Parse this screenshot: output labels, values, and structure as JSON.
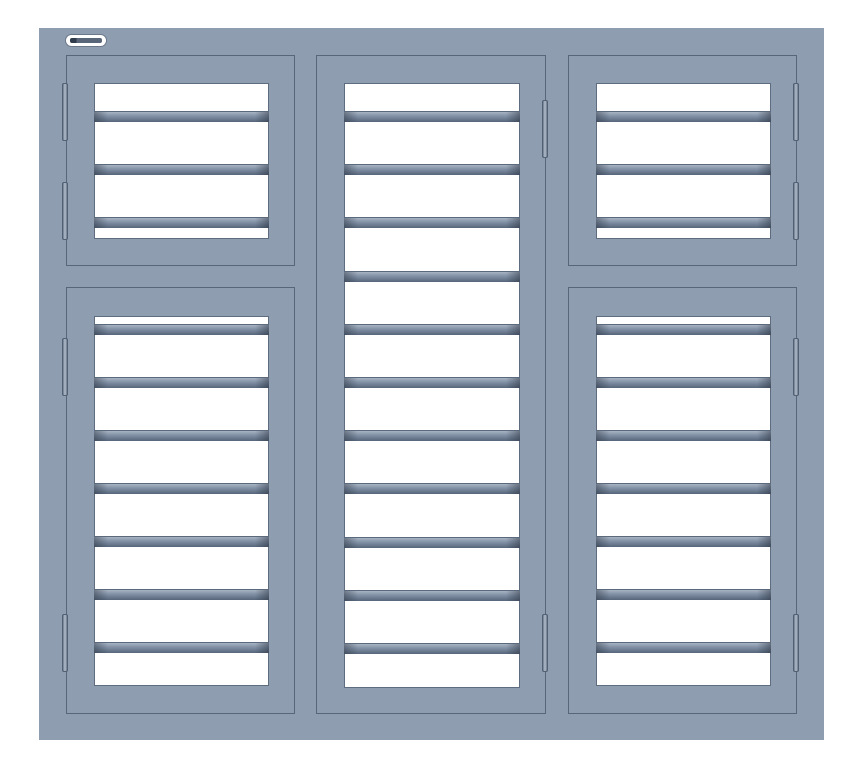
{
  "window": {
    "frame_color": "#8f9db0",
    "glass_color": "#ffffff",
    "bar_color": "#7f8ea3",
    "panels": [
      {
        "name": "panel-top-left",
        "bar_count": 3,
        "hinge_side": "left",
        "hinge_count": 2
      },
      {
        "name": "panel-bottom-left",
        "bar_count": 7,
        "hinge_side": "left",
        "hinge_count": 2
      },
      {
        "name": "panel-center",
        "bar_count": 11,
        "hinge_side": "right",
        "hinge_count": 2
      },
      {
        "name": "panel-top-right",
        "bar_count": 3,
        "hinge_side": "right",
        "hinge_count": 2
      },
      {
        "name": "panel-bottom-right",
        "bar_count": 7,
        "hinge_side": "right",
        "hinge_count": 2
      }
    ]
  },
  "logo": {
    "icon": "brand-logo-icon"
  }
}
